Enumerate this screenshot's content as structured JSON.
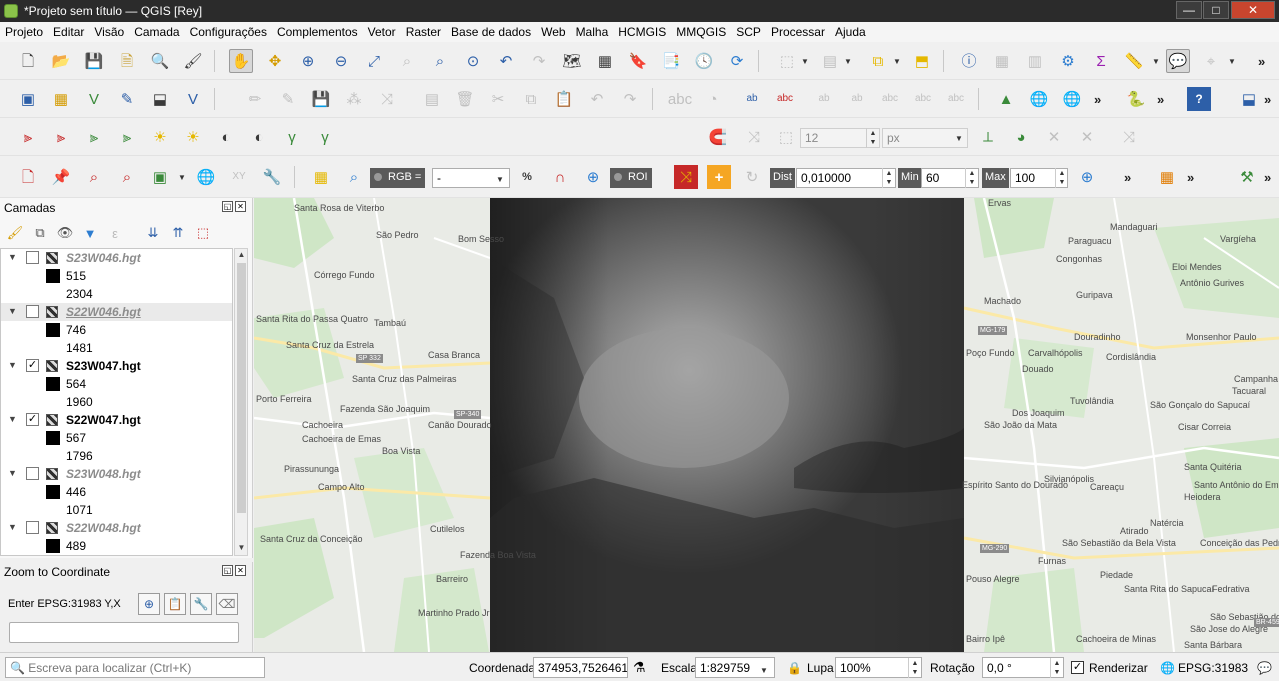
{
  "window": {
    "title": "*Projeto sem título — QGIS [Rey]",
    "minimize": "—",
    "maximize": "□",
    "close": "✕"
  },
  "menu": [
    "Projeto",
    "Editar",
    "Visão",
    "Camada",
    "Configurações",
    "Complementos",
    "Vetor",
    "Raster",
    "Base de dados",
    "Web",
    "Malha",
    "HCMGIS",
    "MMQGIS",
    "SCP",
    "Processar",
    "Ajuda"
  ],
  "toolbar_overflow": "»",
  "digitizing": {
    "size_value": "12",
    "units_value": "px"
  },
  "scp_toolbar": {
    "rgb_label": "RGB =",
    "rgb_value": "-",
    "roi_label": "ROI",
    "dist_label": "Dist",
    "dist_value": "0,010000",
    "min_label": "Min",
    "min_value": "60",
    "max_label": "Max",
    "max_value": "100"
  },
  "layers_panel": {
    "title": "Camadas",
    "rows": [
      {
        "kind": "layer",
        "name": "S23W046.hgt",
        "checked": false
      },
      {
        "kind": "value",
        "value": "515"
      },
      {
        "kind": "value",
        "value": "2304"
      },
      {
        "kind": "layer",
        "name": "S22W046.hgt",
        "checked": false,
        "current": true
      },
      {
        "kind": "value",
        "value": "746"
      },
      {
        "kind": "value",
        "value": "1481"
      },
      {
        "kind": "layer",
        "name": "S23W047.hgt",
        "checked": true
      },
      {
        "kind": "value",
        "value": "564"
      },
      {
        "kind": "value",
        "value": "1960"
      },
      {
        "kind": "layer",
        "name": "S22W047.hgt",
        "checked": true
      },
      {
        "kind": "value",
        "value": "567"
      },
      {
        "kind": "value",
        "value": "1796"
      },
      {
        "kind": "layer",
        "name": "S23W048.hgt",
        "checked": false
      },
      {
        "kind": "value",
        "value": "446"
      },
      {
        "kind": "value",
        "value": "1071"
      },
      {
        "kind": "layer",
        "name": "S22W048.hgt",
        "checked": false
      },
      {
        "kind": "value",
        "value": "489"
      }
    ]
  },
  "zoom_panel": {
    "title": "Zoom to Coordinate",
    "label": "Enter EPSG:31983 Y,X",
    "input_value": ""
  },
  "map": {
    "left_labels": [
      "Santa Rosa de Viterbo",
      "São Pedro",
      "Bom Sesso",
      "Córrego Fundo",
      "Tambaú",
      "Santa Rita do Passa Quatro",
      "Santa Cruz da Estrela",
      "Casa Branca",
      "Santa Cruz das Palmeiras",
      "Porto Ferreira",
      "Fazenda São Joaquim",
      "Canão Dourado",
      "Cachoeira",
      "Cachoeira de Emas",
      "Boa Vista",
      "Pirassununga",
      "Campo Alto",
      "Santa Cruz da Conceição",
      "Cutilelos",
      "Barreiro",
      "Martinho Prado Jr",
      "Fazenda Boa Vista",
      "SP 332",
      "SP-340"
    ],
    "right_labels": [
      "Ervas",
      "Mandaguari",
      "Paraguacu",
      "Congonhas",
      "Eloi Mendes",
      "Vargíeha",
      "Guripava",
      "Antônio Gurives",
      "Machado",
      "Douradinho",
      "Monsenhor Paulo",
      "Poço Fundo",
      "Carvalhópolis",
      "Cordislândia",
      "Douado",
      "Campanha",
      "Tacuaral",
      "Tuvolândia",
      "São Gonçalo do Sapucaí",
      "Dos Joaquim",
      "São João da Mata",
      "Cisar Correia",
      "Silvianópolis",
      "Espírito Santo do Dourado",
      "Santa Quitéria",
      "Santo Antônio do Embirizal",
      "Careaçu",
      "Heiodera",
      "Natércia",
      "Atirado",
      "São Sebastião da Bela Vista",
      "Conceição das Pedras",
      "Furnas",
      "Piedade",
      "Pouso Alegre",
      "Santa Rita do Sapucaí",
      "Fedrativa",
      "São Jose do Alegre",
      "Cachoeira de Minas",
      "Bairro Ipê",
      "São Sebastião dos Polentes",
      "Santa Bárbara",
      "MG-179",
      "MG-290",
      "BR-459"
    ]
  },
  "statusbar": {
    "search_placeholder": "Escreva para localizar (Ctrl+K)",
    "coord_label": "Coordenada",
    "coord_value": "374953,7526461",
    "scale_label": "Escala",
    "scale_value": "1:829759",
    "magnifier_label": "Lupa",
    "magnifier_value": "100%",
    "rotation_label": "Rotação",
    "rotation_value": "0,0 °",
    "render_label": "Renderizar",
    "render_checked": true,
    "crs_label": "EPSG:31983"
  }
}
